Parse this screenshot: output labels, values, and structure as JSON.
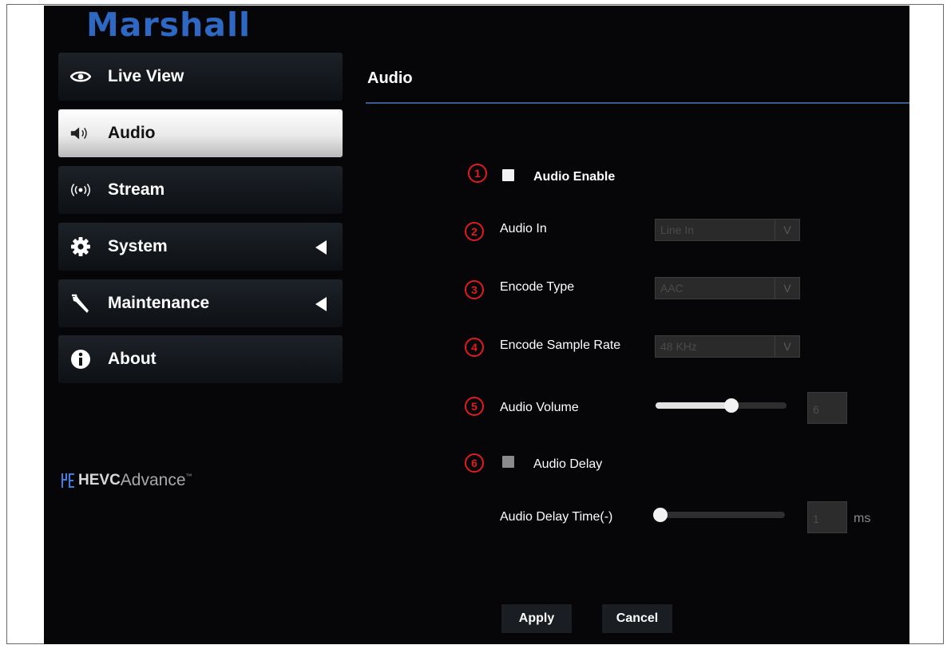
{
  "brand": "Marshall",
  "sidebar": {
    "items": [
      {
        "label": "Live View",
        "icon": "eye-icon"
      },
      {
        "label": "Audio",
        "icon": "speaker-icon"
      },
      {
        "label": "Stream",
        "icon": "broadcast-icon"
      },
      {
        "label": "System",
        "icon": "gear-icon"
      },
      {
        "label": "Maintenance",
        "icon": "wrench-icon"
      },
      {
        "label": "About",
        "icon": "info-icon"
      }
    ],
    "active": "Audio",
    "hevc": {
      "prefix": "HEVC",
      "suffix": "Advance",
      "tm": "™"
    }
  },
  "main": {
    "title": "Audio",
    "annotations": [
      "1",
      "2",
      "3",
      "4",
      "5",
      "6"
    ],
    "audio_enable": {
      "label": "Audio Enable",
      "checked": false
    },
    "audio_in": {
      "label": "Audio In",
      "value": "Line In"
    },
    "encode_type": {
      "label": "Encode Type",
      "value": "AAC"
    },
    "encode_sample_rate": {
      "label": "Encode Sample Rate",
      "value": "48 KHz"
    },
    "audio_volume": {
      "label": "Audio Volume",
      "value": "6",
      "level": 0.58
    },
    "audio_delay": {
      "label": "Audio Delay",
      "checked": false
    },
    "audio_delay_time": {
      "label": "Audio Delay Time(-)",
      "value": "1",
      "unit": "ms",
      "level": 0.0
    }
  },
  "buttons": {
    "apply": "Apply",
    "cancel": "Cancel"
  },
  "colors": {
    "brand": "#2f68c3",
    "annotation": "#e21b1b",
    "rule": "#3a5c8c"
  }
}
